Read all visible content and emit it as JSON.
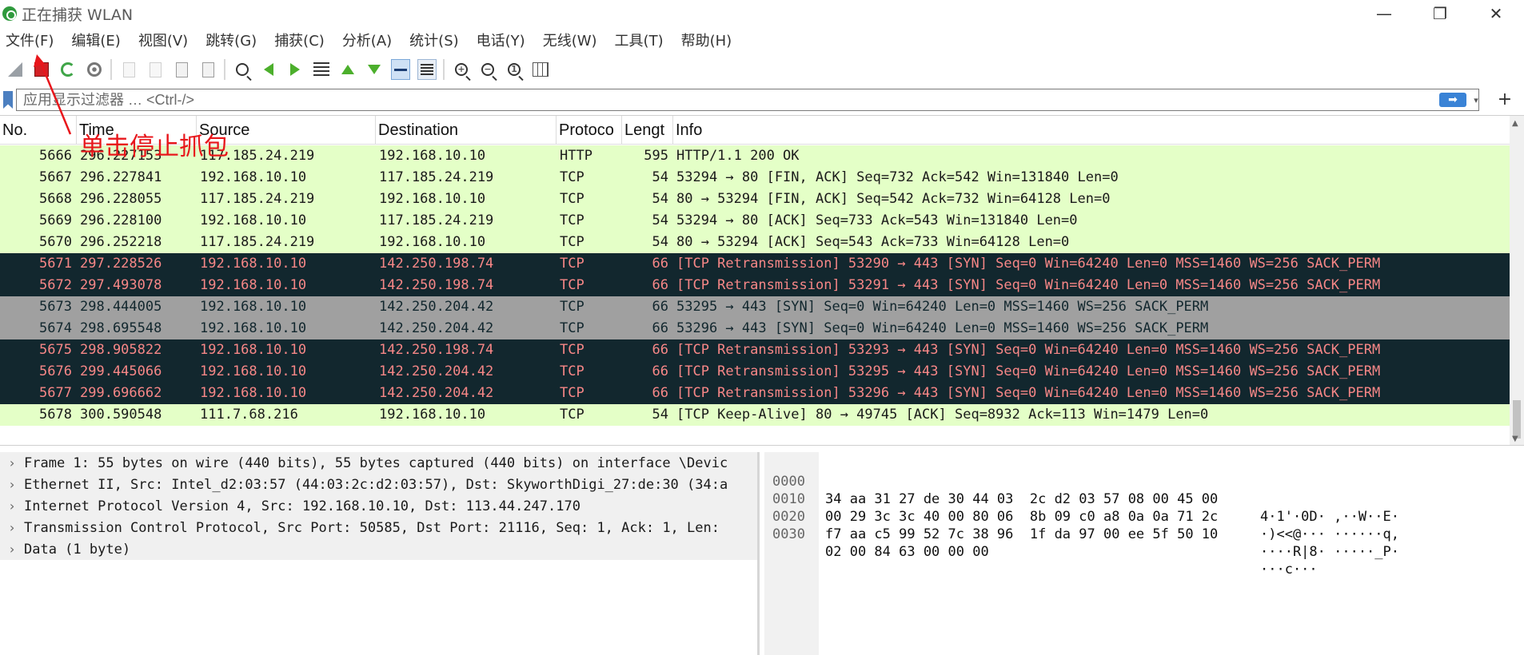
{
  "window": {
    "title": "正在捕获 WLAN",
    "minimize": "—",
    "maximize": "❐",
    "close": "✕"
  },
  "menu": [
    "文件(F)",
    "编辑(E)",
    "视图(V)",
    "跳转(G)",
    "捕获(C)",
    "分析(A)",
    "统计(S)",
    "电话(Y)",
    "无线(W)",
    "工具(T)",
    "帮助(H)"
  ],
  "toolbar_icons": [
    "shark-fin-icon",
    "stop-capture-icon",
    "restart-capture-icon",
    "capture-options-icon",
    "open-file-icon",
    "save-file-icon",
    "close-file-icon",
    "reload-file-icon",
    "find-packet-icon",
    "go-back-icon",
    "go-forward-icon",
    "go-to-packet-icon",
    "go-first-icon",
    "go-last-icon",
    "autoscroll-icon",
    "colorize-icon",
    "zoom-in-icon",
    "zoom-out-icon",
    "normal-size-icon",
    "resize-columns-icon"
  ],
  "filter": {
    "placeholder": "应用显示过滤器 … <Ctrl-/>",
    "apply": "➡",
    "dropdown": "▾",
    "add": "+"
  },
  "annotation": {
    "text": "单击停止抓包",
    "color": "#e8161b"
  },
  "packet_list": {
    "headers": [
      "No.",
      "Time",
      "Source",
      "Destination",
      "Protoco",
      "Lengt",
      "Info"
    ],
    "rows": [
      {
        "no": "5666",
        "time": "296.227153",
        "src": "117.185.24.219",
        "dst": "192.168.10.10",
        "proto": "HTTP",
        "len": "595",
        "info": "HTTP/1.1 200 OK",
        "style": "green"
      },
      {
        "no": "5667",
        "time": "296.227841",
        "src": "192.168.10.10",
        "dst": "117.185.24.219",
        "proto": "TCP",
        "len": "54",
        "info": "53294 → 80 [FIN, ACK] Seq=732 Ack=542 Win=131840 Len=0",
        "style": "green"
      },
      {
        "no": "5668",
        "time": "296.228055",
        "src": "117.185.24.219",
        "dst": "192.168.10.10",
        "proto": "TCP",
        "len": "54",
        "info": "80 → 53294 [FIN, ACK] Seq=542 Ack=732 Win=64128 Len=0",
        "style": "green"
      },
      {
        "no": "5669",
        "time": "296.228100",
        "src": "192.168.10.10",
        "dst": "117.185.24.219",
        "proto": "TCP",
        "len": "54",
        "info": "53294 → 80 [ACK] Seq=733 Ack=543 Win=131840 Len=0",
        "style": "green"
      },
      {
        "no": "5670",
        "time": "296.252218",
        "src": "117.185.24.219",
        "dst": "192.168.10.10",
        "proto": "TCP",
        "len": "54",
        "info": "80 → 53294 [ACK] Seq=543 Ack=733 Win=64128 Len=0",
        "style": "green"
      },
      {
        "no": "5671",
        "time": "297.228526",
        "src": "192.168.10.10",
        "dst": "142.250.198.74",
        "proto": "TCP",
        "len": "66",
        "info": "[TCP Retransmission] 53290 → 443 [SYN] Seq=0 Win=64240 Len=0 MSS=1460 WS=256 SACK_PERM",
        "style": "dark"
      },
      {
        "no": "5672",
        "time": "297.493078",
        "src": "192.168.10.10",
        "dst": "142.250.198.74",
        "proto": "TCP",
        "len": "66",
        "info": "[TCP Retransmission] 53291 → 443 [SYN] Seq=0 Win=64240 Len=0 MSS=1460 WS=256 SACK_PERM",
        "style": "dark"
      },
      {
        "no": "5673",
        "time": "298.444005",
        "src": "192.168.10.10",
        "dst": "142.250.204.42",
        "proto": "TCP",
        "len": "66",
        "info": "53295 → 443 [SYN] Seq=0 Win=64240 Len=0 MSS=1460 WS=256 SACK_PERM",
        "style": "gray"
      },
      {
        "no": "5674",
        "time": "298.695548",
        "src": "192.168.10.10",
        "dst": "142.250.204.42",
        "proto": "TCP",
        "len": "66",
        "info": "53296 → 443 [SYN] Seq=0 Win=64240 Len=0 MSS=1460 WS=256 SACK_PERM",
        "style": "gray"
      },
      {
        "no": "5675",
        "time": "298.905822",
        "src": "192.168.10.10",
        "dst": "142.250.198.74",
        "proto": "TCP",
        "len": "66",
        "info": "[TCP Retransmission] 53293 → 443 [SYN] Seq=0 Win=64240 Len=0 MSS=1460 WS=256 SACK_PERM",
        "style": "dark"
      },
      {
        "no": "5676",
        "time": "299.445066",
        "src": "192.168.10.10",
        "dst": "142.250.204.42",
        "proto": "TCP",
        "len": "66",
        "info": "[TCP Retransmission] 53295 → 443 [SYN] Seq=0 Win=64240 Len=0 MSS=1460 WS=256 SACK_PERM",
        "style": "dark"
      },
      {
        "no": "5677",
        "time": "299.696662",
        "src": "192.168.10.10",
        "dst": "142.250.204.42",
        "proto": "TCP",
        "len": "66",
        "info": "[TCP Retransmission] 53296 → 443 [SYN] Seq=0 Win=64240 Len=0 MSS=1460 WS=256 SACK_PERM",
        "style": "dark"
      },
      {
        "no": "5678",
        "time": "300.590548",
        "src": "111.7.68.216",
        "dst": "192.168.10.10",
        "proto": "TCP",
        "len": "54",
        "info": "[TCP Keep-Alive] 80 → 49745 [ACK] Seq=8932 Ack=113 Win=1479 Len=0",
        "style": "green"
      }
    ]
  },
  "details": [
    "Frame 1: 55 bytes on wire (440 bits), 55 bytes captured (440 bits) on interface \\Devic",
    "Ethernet II, Src: Intel_d2:03:57 (44:03:2c:d2:03:57), Dst: SkyworthDigi_27:de:30 (34:a",
    "Internet Protocol Version 4, Src: 192.168.10.10, Dst: 113.44.247.170",
    "Transmission Control Protocol, Src Port: 50585, Dst Port: 21116, Seq: 1, Ack: 1, Len:",
    "Data (1 byte)"
  ],
  "bytes": [
    {
      "offset": "0000",
      "hex": "34 aa 31 27 de 30 44 03  2c d2 03 57 08 00 45 00",
      "ascii": "4·1'·0D· ,··W··E·"
    },
    {
      "offset": "0010",
      "hex": "00 29 3c 3c 40 00 80 06  8b 09 c0 a8 0a 0a 71 2c",
      "ascii": "·)<<@··· ······q,"
    },
    {
      "offset": "0020",
      "hex": "f7 aa c5 99 52 7c 38 96  1f da 97 00 ee 5f 50 10",
      "ascii": "····R|8· ·····_P·"
    },
    {
      "offset": "0030",
      "hex": "02 00 84 63 00 00 00",
      "ascii": "···c···"
    }
  ],
  "colors": {
    "green_row_bg": "#e4ffc7",
    "dark_row_bg": "#12272e",
    "dark_row_fg": "#f78787",
    "gray_row_bg": "#a0a0a0",
    "stop_button": "#d32024"
  }
}
